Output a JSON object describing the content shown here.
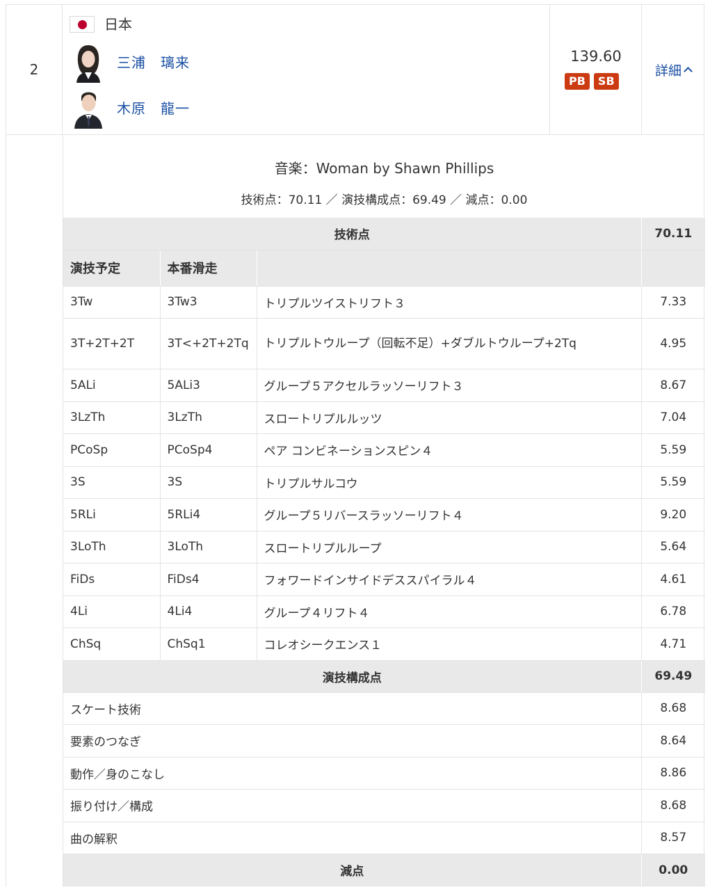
{
  "entry": {
    "rank": "2",
    "country": "日本",
    "athletes": [
      {
        "name": "三浦　璃来"
      },
      {
        "name": "木原　龍一"
      }
    ],
    "total_score": "139.60",
    "badges": [
      "PB",
      "SB"
    ],
    "detail_label": "詳細"
  },
  "detail": {
    "music": "音楽：Woman by Shawn Phillips",
    "summary": "技術点：70.11 ／ 演技構成点：69.49 ／ 減点：0.00",
    "technical": {
      "title": "技術点",
      "total": "70.11",
      "col_planned": "演技予定",
      "col_executed": "本番滑走",
      "elements": [
        {
          "planned": "3Tw",
          "executed": "3Tw3",
          "name": "トリプルツイストリフト３",
          "score": "7.33"
        },
        {
          "planned": "3T+2T+2T",
          "executed": "3T<+2T+2Tq",
          "name": "トリプルトウループ（回転不足）+ダブルトウループ+2Tq",
          "score": "4.95"
        },
        {
          "planned": "5ALi",
          "executed": "5ALi3",
          "name": "グループ５アクセルラッソーリフト３",
          "score": "8.67"
        },
        {
          "planned": "3LzTh",
          "executed": "3LzTh",
          "name": "スロートリプルルッツ",
          "score": "7.04"
        },
        {
          "planned": "PCoSp",
          "executed": "PCoSp4",
          "name": "ペア コンビネーションスピン４",
          "score": "5.59"
        },
        {
          "planned": "3S",
          "executed": "3S",
          "name": "トリプルサルコウ",
          "score": "5.59"
        },
        {
          "planned": "5RLi",
          "executed": "5RLi4",
          "name": "グループ５リバースラッソーリフト４",
          "score": "9.20"
        },
        {
          "planned": "3LoTh",
          "executed": "3LoTh",
          "name": "スロートリプルループ",
          "score": "5.64"
        },
        {
          "planned": "FiDs",
          "executed": "FiDs4",
          "name": "フォワードインサイドデススパイラル４",
          "score": "4.61"
        },
        {
          "planned": "4Li",
          "executed": "4Li4",
          "name": "グループ４リフト４",
          "score": "6.78"
        },
        {
          "planned": "ChSq",
          "executed": "ChSq1",
          "name": "コレオシークエンス１",
          "score": "4.71"
        }
      ]
    },
    "components": {
      "title": "演技構成点",
      "total": "69.49",
      "items": [
        {
          "name": "スケート技術",
          "score": "8.68"
        },
        {
          "name": "要素のつなぎ",
          "score": "8.64"
        },
        {
          "name": "動作／身のこなし",
          "score": "8.86"
        },
        {
          "name": "振り付け／構成",
          "score": "8.68"
        },
        {
          "name": "曲の解釈",
          "score": "8.57"
        }
      ]
    },
    "deductions": {
      "title": "減点",
      "total": "0.00"
    }
  }
}
